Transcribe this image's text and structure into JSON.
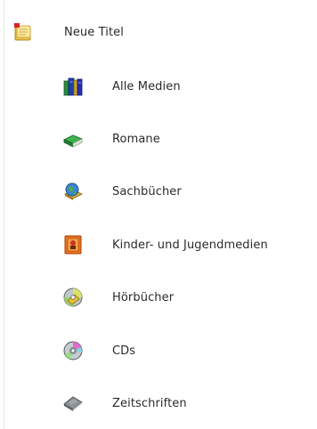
{
  "nav": {
    "parent": {
      "label": "Neue Titel",
      "icon": "new-titles-icon"
    },
    "items": [
      {
        "label": "Alle Medien",
        "icon": "books-icon"
      },
      {
        "label": "Romane",
        "icon": "green-book-icon"
      },
      {
        "label": "Sachbücher",
        "icon": "globe-book-icon"
      },
      {
        "label": "Kinder- und Jugendmedien",
        "icon": "children-book-icon"
      },
      {
        "label": "Hörbücher",
        "icon": "audiobook-cd-icon"
      },
      {
        "label": "CDs",
        "icon": "cd-icon"
      },
      {
        "label": "Zeitschriften",
        "icon": "magazine-icon"
      }
    ]
  },
  "colors": {
    "text": "#2a2a2a",
    "edge": "#e4e4e4"
  }
}
